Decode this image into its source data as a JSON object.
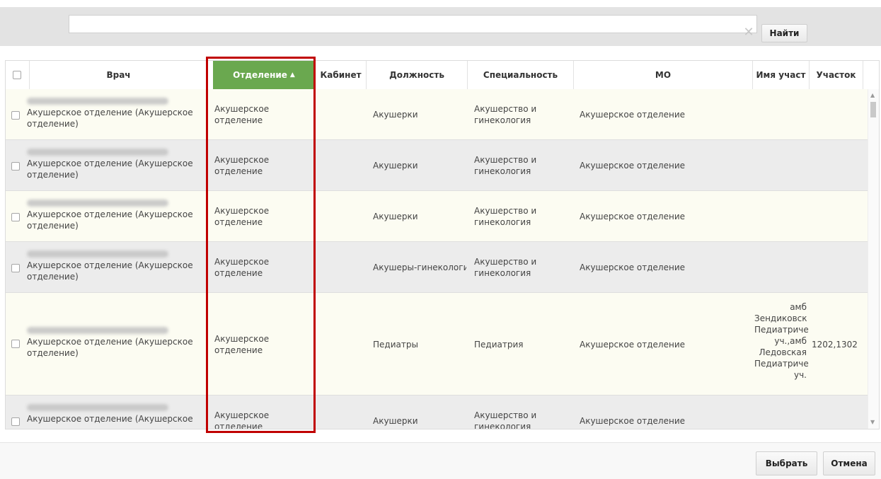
{
  "search": {
    "value": "",
    "placeholder": "",
    "clear_glyph": "✕",
    "find_label": "Найти"
  },
  "columns": {
    "doctor": "Врач",
    "department": "Отделение",
    "cabinet": "Кабинет",
    "position": "Должность",
    "specialty": "Специальность",
    "mo": "МО",
    "site_name": "Имя участ",
    "site": "Участок"
  },
  "sort": {
    "column": "department",
    "direction": "asc",
    "caret": "▲"
  },
  "rows": [
    {
      "doctor_name": "[blurred]",
      "doctor_dept": "Акушерское отделение (Акушерское отделение)",
      "department": "Акушерское отделение",
      "cabinet": "",
      "position": "Акушерки",
      "specialty": "Акушерство и гинекология",
      "mo": "Акушерское отделение",
      "site_name": "",
      "site": ""
    },
    {
      "doctor_name": "[blurred]",
      "doctor_dept": "Акушерское отделение (Акушерское отделение)",
      "department": "Акушерское отделение",
      "cabinet": "",
      "position": "Акушерки",
      "specialty": "Акушерство и гинекология",
      "mo": "Акушерское отделение",
      "site_name": "",
      "site": ""
    },
    {
      "doctor_name": "[blurred]",
      "doctor_dept": "Акушерское отделение (Акушерское отделение)",
      "department": "Акушерское отделение",
      "cabinet": "",
      "position": "Акушерки",
      "specialty": "Акушерство и гинекология",
      "mo": "Акушерское отделение",
      "site_name": "",
      "site": ""
    },
    {
      "doctor_name": "[blurred]",
      "doctor_dept": "Акушерское отделение (Акушерское отделение)",
      "department": "Акушерское отделение",
      "cabinet": "",
      "position": "Акушеры-гинекологи",
      "specialty": "Акушерство и гинекология",
      "mo": "Акушерское отделение",
      "site_name": "",
      "site": ""
    },
    {
      "doctor_name": "[blurred]",
      "doctor_dept": "Акушерское отделение (Акушерское отделение)",
      "department": "Акушерское отделение",
      "cabinet": "",
      "position": "Педиатры",
      "specialty": "Педиатрия",
      "mo": "Акушерское отделение",
      "site_name": "амб Зендиковская Педиатрический уч.,амб Ледовская Педиатрический уч.",
      "site": "1202,1302"
    },
    {
      "doctor_name": "[blurred]",
      "doctor_dept": "Акушерское отделение (Акушерское",
      "department": "Акушерское отделение",
      "cabinet": "",
      "position": "Акушерки",
      "specialty": "Акушерство и гинекология",
      "mo": "Акушерское отделение",
      "site_name": "",
      "site": ""
    }
  ],
  "site_name_lines": [
    "амб",
    "Зендиковск",
    "Педиатриче",
    "уч.,амб",
    "Ледовская",
    "Педиатриче",
    "уч."
  ],
  "actions": {
    "select_label": "Выбрать",
    "cancel_label": "Отмена"
  },
  "colors": {
    "active_header": "#6aa84f",
    "highlight": "#c00000",
    "row_light": "#fcfcf2",
    "row_dark": "#ececec"
  }
}
